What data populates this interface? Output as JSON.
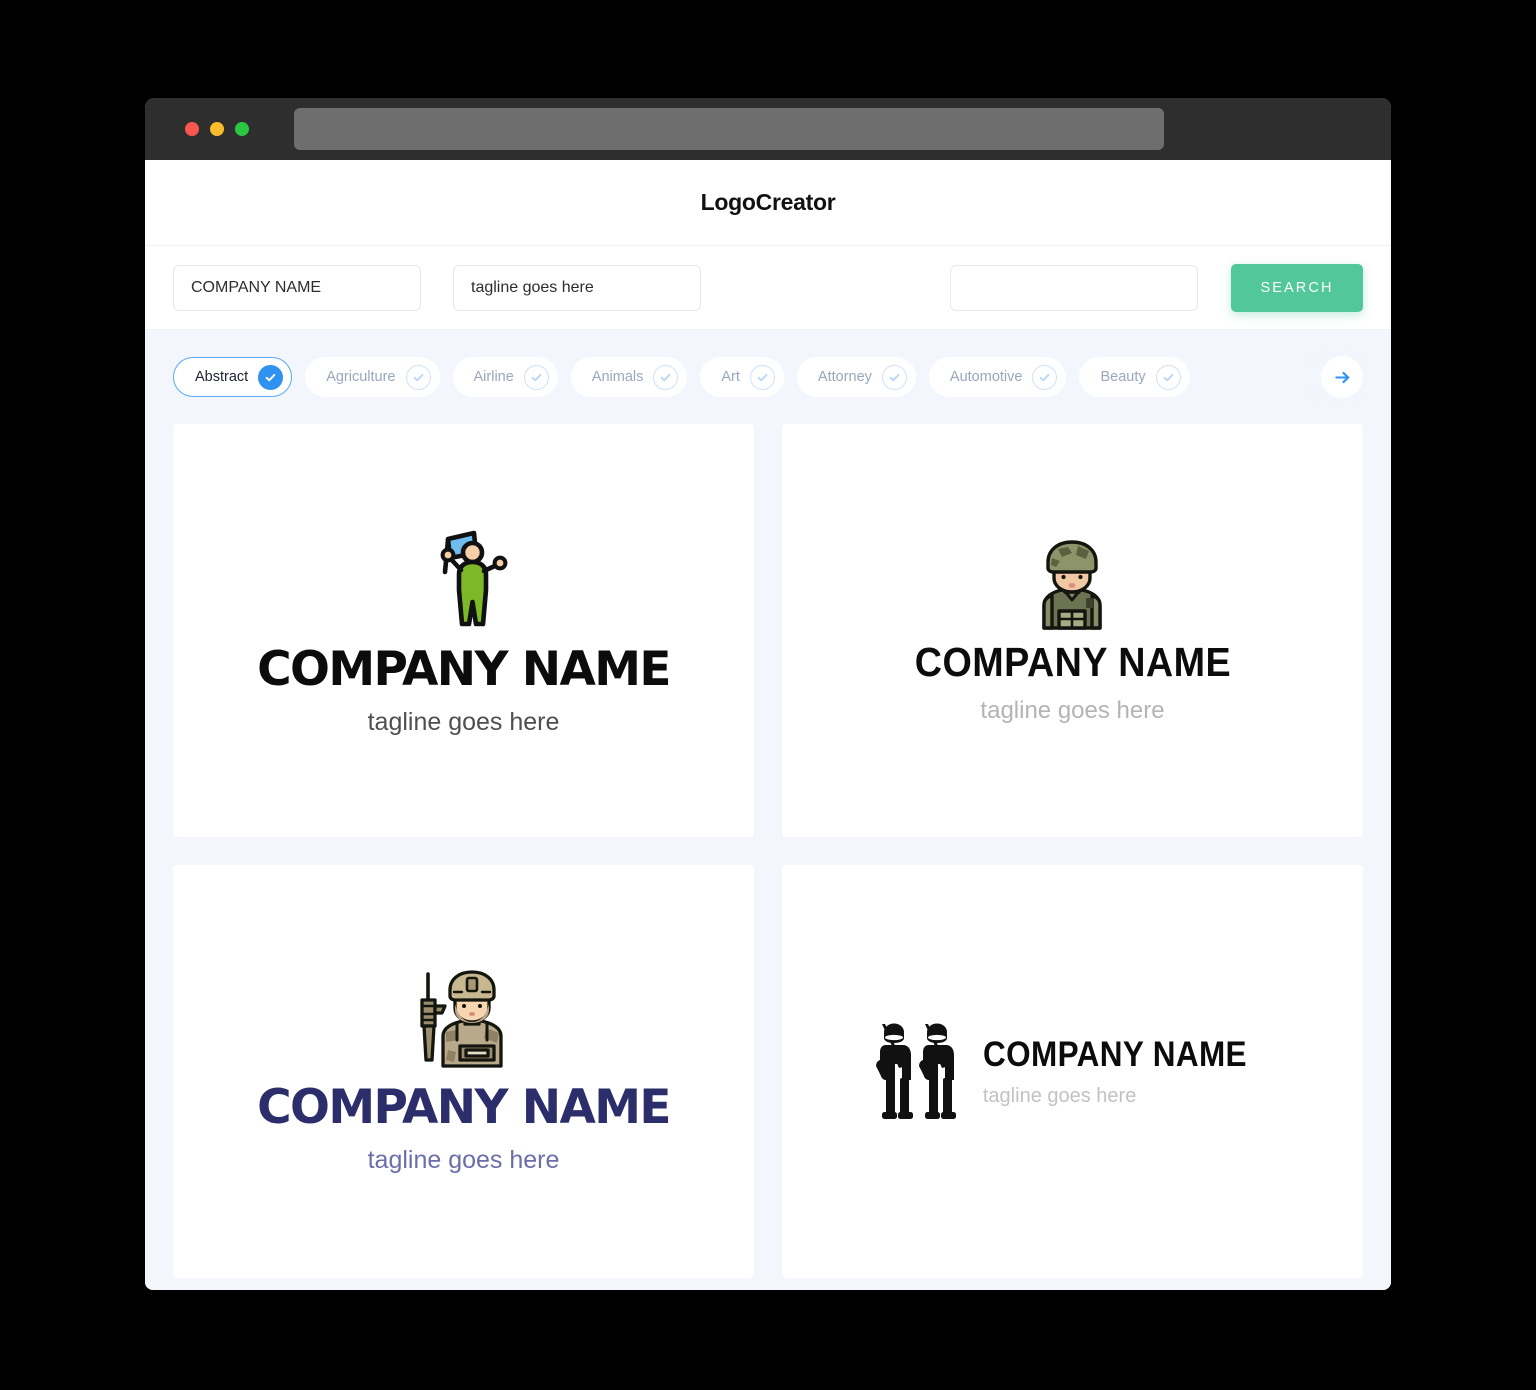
{
  "window": {
    "traffic_lights": [
      "close",
      "minimize",
      "maximize"
    ],
    "address_value": ""
  },
  "header": {
    "brand": "LogoCreator"
  },
  "search": {
    "company_value": "COMPANY NAME",
    "company_placeholder": "COMPANY NAME",
    "tagline_value": "tagline goes here",
    "tagline_placeholder": "tagline goes here",
    "extra_value": "",
    "extra_placeholder": "",
    "button_label": "SEARCH",
    "button_color": "#52c79a"
  },
  "categories": {
    "next_icon": "arrow-right-icon",
    "accent_color": "#2f91f0",
    "items": [
      {
        "label": "Abstract",
        "selected": true,
        "icon": "check-circle-icon"
      },
      {
        "label": "Agriculture",
        "selected": false,
        "icon": "check-circle-icon"
      },
      {
        "label": "Airline",
        "selected": false,
        "icon": "check-circle-icon"
      },
      {
        "label": "Animals",
        "selected": false,
        "icon": "check-circle-icon"
      },
      {
        "label": "Art",
        "selected": false,
        "icon": "check-circle-icon"
      },
      {
        "label": "Attorney",
        "selected": false,
        "icon": "check-circle-icon"
      },
      {
        "label": "Automotive",
        "selected": false,
        "icon": "check-circle-icon"
      },
      {
        "label": "Beauty",
        "selected": false,
        "icon": "check-circle-icon"
      }
    ]
  },
  "results": [
    {
      "id": "logo-1",
      "icon": "person-waving-flag-icon",
      "layout": "vertical",
      "name": "COMPANY NAME",
      "tagline": "tagline goes here",
      "name_color": "#0c0c0c",
      "tagline_color": "#4f4f4f"
    },
    {
      "id": "logo-2",
      "icon": "soldier-bust-icon",
      "layout": "vertical",
      "name": "COMPANY NAME",
      "tagline": "tagline goes here",
      "name_color": "#0c0c0c",
      "tagline_color": "#b4b4b4"
    },
    {
      "id": "logo-3",
      "icon": "soldier-with-rifle-icon",
      "layout": "vertical",
      "name": "COMPANY NAME",
      "tagline": "tagline goes here",
      "name_color": "#2c2e6b",
      "tagline_color": "#6b6ea8"
    },
    {
      "id": "logo-4",
      "icon": "two-soldiers-silhouette-icon",
      "layout": "horizontal",
      "name": "COMPANY NAME",
      "tagline": "tagline goes here",
      "name_color": "#0c0c0c",
      "tagline_color": "#c2c2c2"
    }
  ]
}
